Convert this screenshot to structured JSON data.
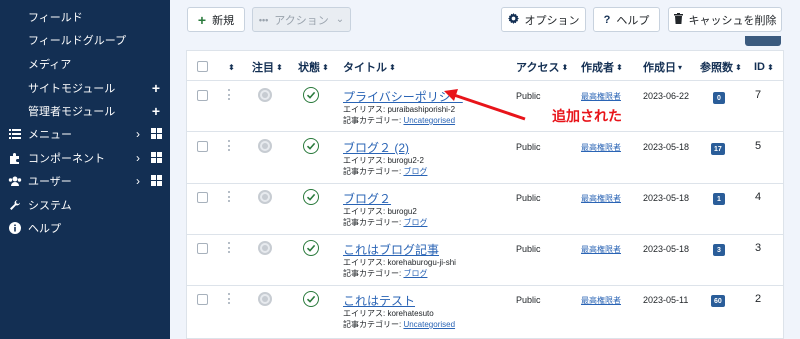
{
  "sidebar": {
    "items": [
      {
        "label": "フィールド",
        "kind": "sub"
      },
      {
        "label": "フィールドグループ",
        "kind": "sub"
      },
      {
        "label": "メディア",
        "kind": "sub"
      },
      {
        "label": "サイトモジュール",
        "kind": "sub",
        "plus": "+"
      },
      {
        "label": "管理者モジュール",
        "kind": "sub",
        "plus": "+"
      },
      {
        "label": "メニュー",
        "kind": "top",
        "icon": "list-icon",
        "chevron": "›"
      },
      {
        "label": "コンポーネント",
        "kind": "top",
        "icon": "puzzle-icon",
        "chevron": "›"
      },
      {
        "label": "ユーザー",
        "kind": "top",
        "icon": "users-icon",
        "chevron": "›"
      },
      {
        "label": "システム",
        "kind": "top",
        "icon": "wrench-icon"
      },
      {
        "label": "ヘルプ",
        "kind": "top",
        "icon": "info-icon"
      }
    ]
  },
  "toolbar": {
    "new_label": "新規",
    "action_label": "アクション",
    "options_label": "オプション",
    "help_label": "ヘルプ",
    "cancel_label": "キャッシュを削除"
  },
  "table": {
    "headers": {
      "featured": "注目",
      "status": "状態",
      "title": "タイトル",
      "access": "アクセス",
      "author": "作成者",
      "date": "作成日",
      "hits": "参照数",
      "id": "ID"
    },
    "rows": [
      {
        "title": "プライバシーポリシー",
        "alias": "エイリアス: puraibashiporishi-2",
        "cat_prefix": "記事カテゴリー: ",
        "category": "Uncategorised",
        "access": "Public",
        "author": "最高権限者",
        "date": "2023-06-22",
        "hits": "0",
        "id": "7"
      },
      {
        "title": "ブログ２ (2)",
        "alias": "エイリアス: burogu2-2",
        "cat_prefix": "記事カテゴリー: ",
        "category": "ブログ",
        "access": "Public",
        "author": "最高権限者",
        "date": "2023-05-18",
        "hits": "17",
        "id": "5"
      },
      {
        "title": "ブログ２",
        "alias": "エイリアス: burogu2",
        "cat_prefix": "記事カテゴリー: ",
        "category": "ブログ",
        "access": "Public",
        "author": "最高権限者",
        "date": "2023-05-18",
        "hits": "1",
        "id": "4"
      },
      {
        "title": "これはブログ記事",
        "alias": "エイリアス: korehaburogu-ji-shi",
        "cat_prefix": "記事カテゴリー: ",
        "category": "ブログ",
        "access": "Public",
        "author": "最高権限者",
        "date": "2023-05-18",
        "hits": "3",
        "id": "3"
      },
      {
        "title": "これはテスト",
        "alias": "エイリアス: korehatesuto",
        "cat_prefix": "記事カテゴリー: ",
        "category": "Uncategorised",
        "access": "Public",
        "author": "最高権限者",
        "date": "2023-05-11",
        "hits": "60",
        "id": "2"
      }
    ]
  },
  "annotation": {
    "text": "追加された",
    "color": "#e8141a"
  },
  "colors": {
    "sidebar_bg": "#132f53",
    "link": "#2a64b5",
    "badge": "#2a5d99",
    "published": "#2a7a3c"
  }
}
